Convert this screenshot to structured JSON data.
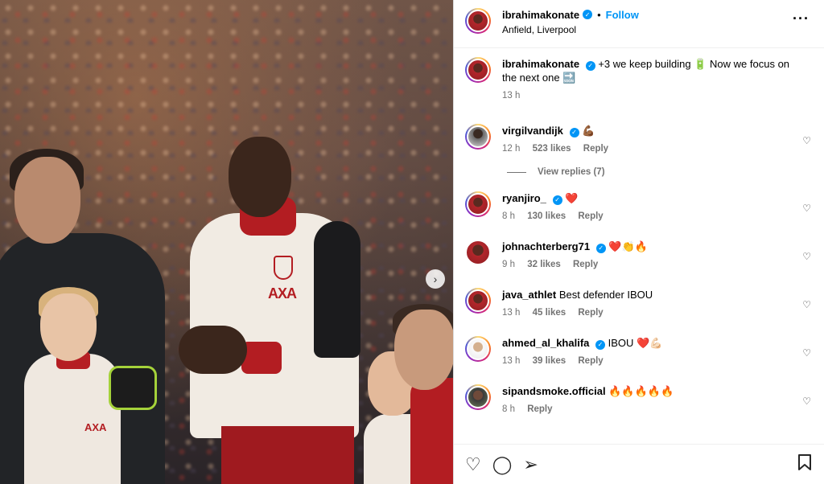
{
  "header": {
    "username": "ibrahimakonate",
    "follow_label": "Follow",
    "location": "Anfield, Liverpool"
  },
  "caption": {
    "username": "ibrahimakonate",
    "text": "+3 we keep building 🔋 Now we focus on the next one 🔜",
    "time": "13 h"
  },
  "comments": [
    {
      "username": "virgilvandijk",
      "verified": true,
      "text": "💪🏾",
      "time": "12 h",
      "likes": "523 likes",
      "reply": "Reply",
      "avatar": "virgil"
    },
    {
      "username": "ryanjiro_",
      "verified": true,
      "text": "❤️",
      "time": "8 h",
      "likes": "130 likes",
      "reply": "Reply",
      "avatar": "red"
    },
    {
      "username": "johnachterberg71",
      "verified": true,
      "text": "❤️👏🔥",
      "time": "9 h",
      "likes": "32 likes",
      "reply": "Reply",
      "avatar": "plain"
    },
    {
      "username": "java_athlet",
      "verified": false,
      "text": "Best defender IBOU",
      "time": "13 h",
      "likes": "45 likes",
      "reply": "Reply",
      "avatar": "red"
    },
    {
      "username": "ahmed_al_khalifa",
      "verified": true,
      "text": "IBOU ❤️💪🏻",
      "time": "13 h",
      "likes": "39 likes",
      "reply": "Reply",
      "avatar": "white"
    },
    {
      "username": "sipandsmoke.official",
      "verified": false,
      "text": "🔥🔥🔥🔥🔥",
      "time": "8 h",
      "likes": "",
      "reply": "Reply",
      "avatar": "dark"
    }
  ],
  "view_replies": "View replies (7)",
  "photo": {
    "sponsor": "AXA",
    "next_icon": "chevron-right-icon"
  },
  "actions": {
    "icons": [
      "heart-icon",
      "comment-icon",
      "share-icon",
      "bookmark-icon"
    ]
  }
}
